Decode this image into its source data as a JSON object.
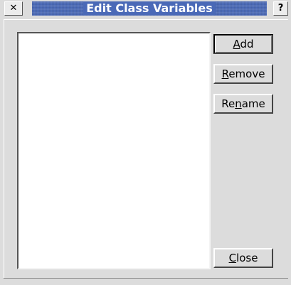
{
  "window": {
    "title": "Edit Class Variables",
    "close_glyph": "✕",
    "help_glyph": "?"
  },
  "buttons": {
    "add": {
      "mnemonic": "A",
      "rest": "dd"
    },
    "remove": {
      "mnemonic": "R",
      "rest": "emove"
    },
    "rename": {
      "pre": "Re",
      "mnemonic": "n",
      "rest": "ame"
    },
    "close": {
      "mnemonic": "C",
      "rest": "lose"
    }
  },
  "list": {
    "items": []
  },
  "colors": {
    "titlebar": "#4a69b7",
    "face": "#dcdcdc",
    "list_bg": "#ffffff"
  }
}
